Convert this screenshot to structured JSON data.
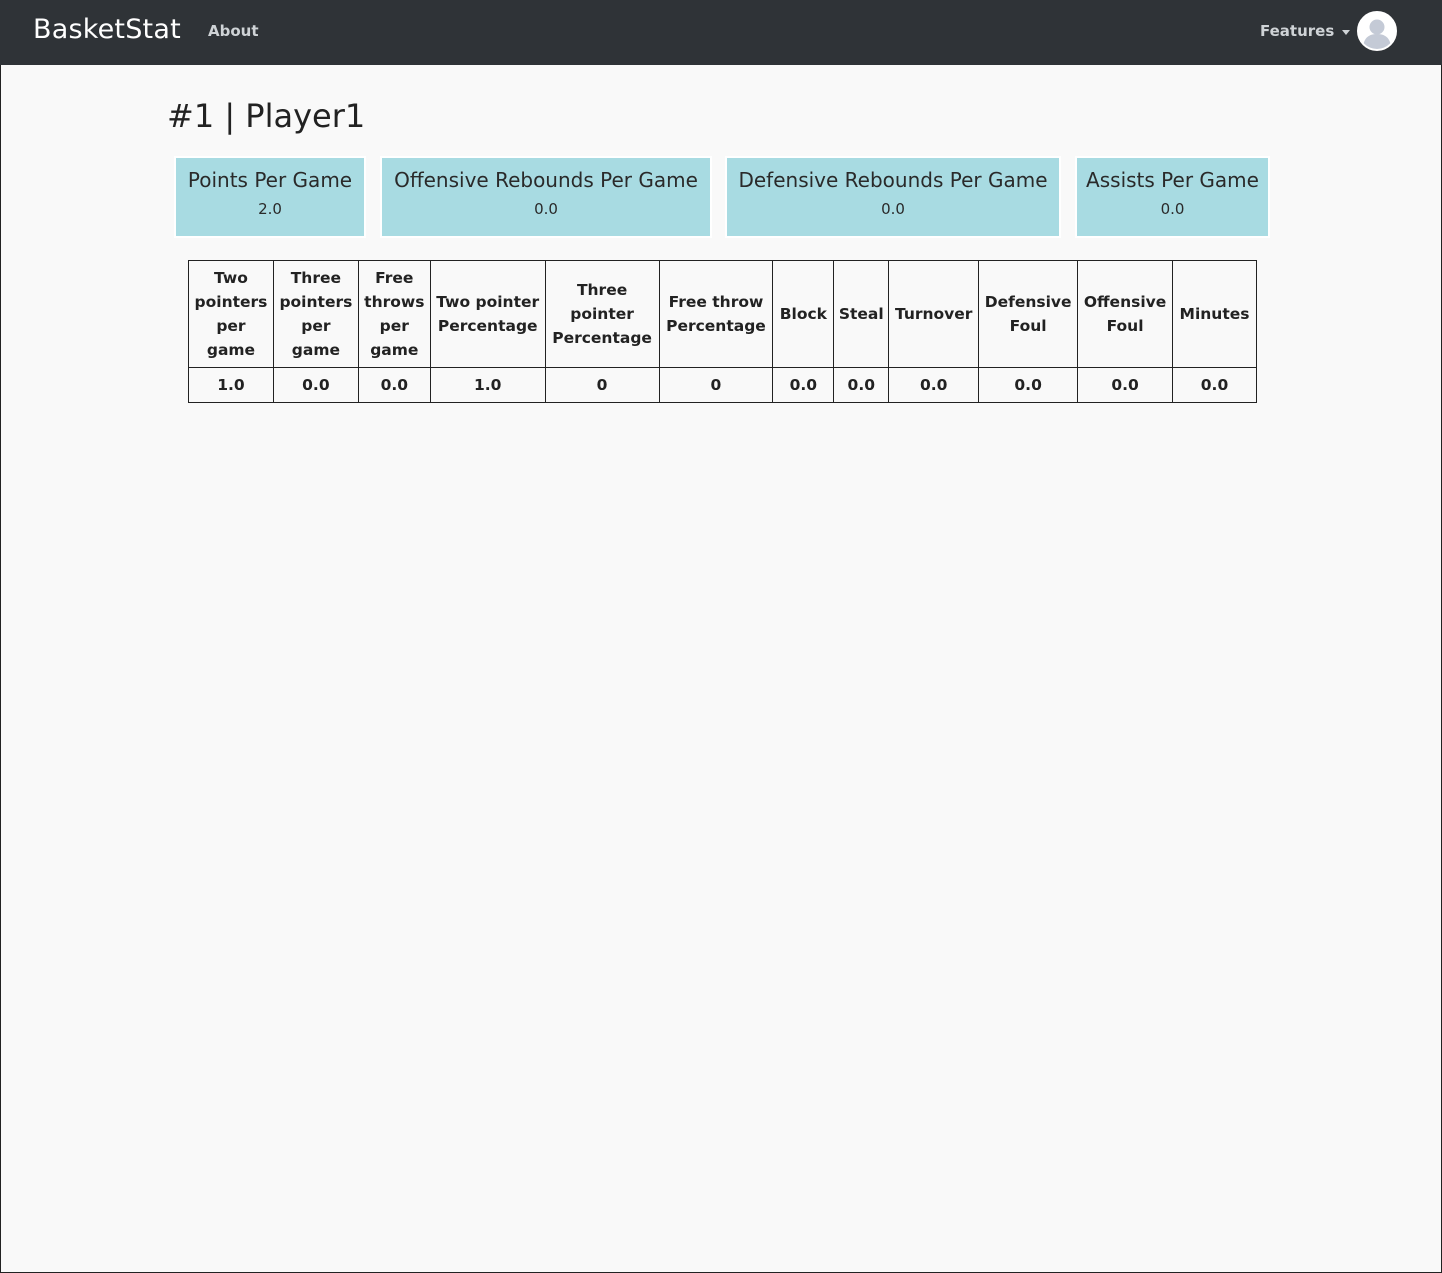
{
  "navbar": {
    "brand": "BasketStat",
    "about_label": "About",
    "features_label": "Features"
  },
  "page": {
    "title": "#1 | Player1"
  },
  "cards": [
    {
      "title": "Points Per Game",
      "value": "2.0"
    },
    {
      "title": "Offensive Rebounds Per Game",
      "value": "0.0"
    },
    {
      "title": "Defensive Rebounds Per Game",
      "value": "0.0"
    },
    {
      "title": "Assists Per Game",
      "value": "0.0"
    }
  ],
  "table": {
    "headers": [
      "Two pointers per game",
      "Three pointers per game",
      "Free throws per game",
      "Two pointer Percentage",
      "Three pointer Percentage",
      "Free throw Percentage",
      "Block",
      "Steal",
      "Turnover",
      "Defensive Foul",
      "Offensive Foul",
      "Minutes"
    ],
    "row": [
      "1.0",
      "0.0",
      "0.0",
      "1.0",
      "0",
      "0",
      "0.0",
      "0.0",
      "0.0",
      "0.0",
      "0.0",
      "0.0"
    ]
  },
  "colors": {
    "navbar": "#2f3337",
    "card": "#a8dbe2",
    "page_bg": "#f9f9f9"
  }
}
